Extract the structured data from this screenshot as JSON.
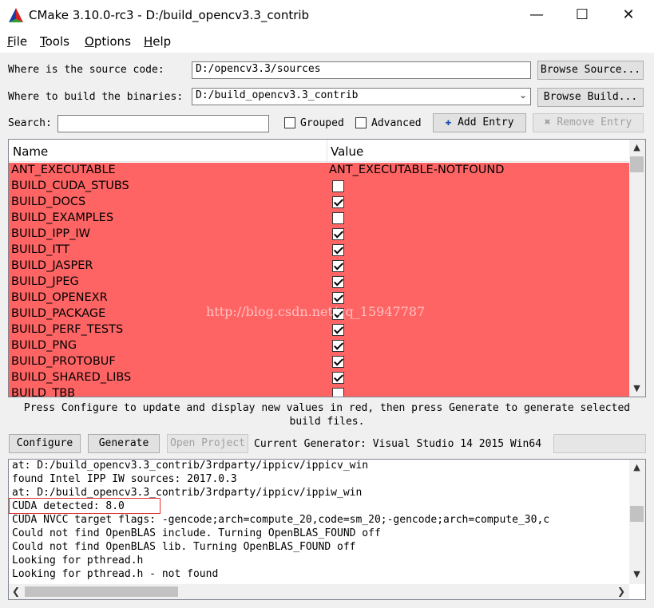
{
  "window": {
    "title": "CMake 3.10.0-rc3 - D:/build_opencv3.3_contrib",
    "minimize": "—",
    "maximize": "☐",
    "close": "✕"
  },
  "menu": [
    {
      "label": "File",
      "key": "F",
      "rest": "ile"
    },
    {
      "label": "Tools",
      "key": "T",
      "rest": "ools"
    },
    {
      "label": "Options",
      "key": "O",
      "rest": "ptions"
    },
    {
      "label": "Help",
      "key": "H",
      "rest": "elp"
    }
  ],
  "source": {
    "label": "Where is the source code:",
    "value": "D:/opencv3.3/sources",
    "button": "Browse Source..."
  },
  "build": {
    "label": "Where to build the binaries:",
    "value": "D:/build_opencv3.3_contrib",
    "button": "Browse Build..."
  },
  "search": {
    "label": "Search:",
    "value": ""
  },
  "options": {
    "grouped": "Grouped",
    "advanced": "Advanced",
    "add_entry": "Add Entry",
    "remove_entry": "Remove Entry"
  },
  "table": {
    "col_name": "Name",
    "col_value": "Value",
    "rows": [
      {
        "name": "ANT_EXECUTABLE",
        "value": "ANT_EXECUTABLE-NOTFOUND"
      },
      {
        "name": "BUILD_CUDA_STUBS",
        "checked": false
      },
      {
        "name": "BUILD_DOCS",
        "checked": true
      },
      {
        "name": "BUILD_EXAMPLES",
        "checked": false
      },
      {
        "name": "BUILD_IPP_IW",
        "checked": true
      },
      {
        "name": "BUILD_ITT",
        "checked": true
      },
      {
        "name": "BUILD_JASPER",
        "checked": true
      },
      {
        "name": "BUILD_JPEG",
        "checked": true
      },
      {
        "name": "BUILD_OPENEXR",
        "checked": true
      },
      {
        "name": "BUILD_PACKAGE",
        "checked": true
      },
      {
        "name": "BUILD_PERF_TESTS",
        "checked": true
      },
      {
        "name": "BUILD_PNG",
        "checked": true
      },
      {
        "name": "BUILD_PROTOBUF",
        "checked": true
      },
      {
        "name": "BUILD_SHARED_LIBS",
        "checked": true
      },
      {
        "name": "BUILD_TBB",
        "checked": false
      }
    ]
  },
  "hint": "Press Configure to update and display new values in red, then press Generate to generate selected build files.",
  "actions": {
    "configure": "Configure",
    "generate": "Generate",
    "open_project": "Open Project",
    "generator": "Current Generator: Visual Studio 14 2015 Win64"
  },
  "log": [
    "at: D:/build_opencv3.3_contrib/3rdparty/ippicv/ippicv_win",
    "found Intel IPP IW sources: 2017.0.3",
    "at: D:/build_opencv3.3_contrib/3rdparty/ippicv/ippiw_win",
    "CUDA detected: 8.0",
    "CUDA NVCC target flags: -gencode;arch=compute_20,code=sm_20;-gencode;arch=compute_30,c",
    "Could not find OpenBLAS include. Turning OpenBLAS_FOUND off",
    "Could not find OpenBLAS lib. Turning OpenBLAS_FOUND off",
    "Looking for pthread.h",
    "Looking for pthread.h - not found"
  ],
  "watermark": "http://blog.csdn.net/qq_15947787",
  "colors": {
    "changed_row": "#ff6464",
    "highlight_box": "#e03030"
  }
}
